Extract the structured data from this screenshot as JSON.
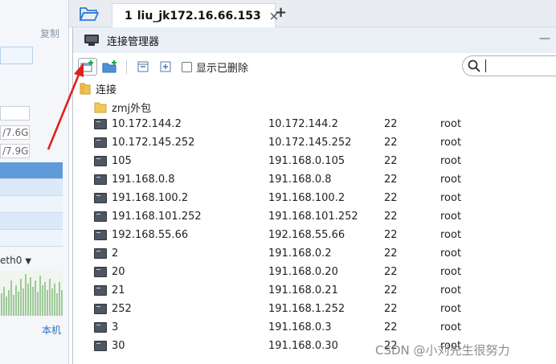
{
  "left_panel": {
    "copy_label": "复制",
    "mem_value_1": "/7.6G",
    "mem_value_2": "/7.9G",
    "interface_select": "eth0",
    "local_label": "本机"
  },
  "tabbar": {
    "folder_icon": "folder-open-icon",
    "session_tab": {
      "number": "1",
      "title": "liu_jk172.16.66.153",
      "close": "×",
      "status_color": "#1bb35b"
    },
    "add_tab": "+"
  },
  "conn_manager": {
    "title": "连接管理器",
    "minimize": "—",
    "toolbar": {
      "new_session_icon": "new-session-icon",
      "new_folder_icon": "new-folder-icon",
      "collapse_icon": "collapse-icon",
      "expand_icon": "expand-icon",
      "show_deleted_label": "显示已删除"
    },
    "search": {
      "placeholder": "",
      "icon": "search-icon"
    },
    "tree": {
      "root_label": "连接",
      "group_label": "zmj外包",
      "sessions": [
        {
          "name": "10.172.144.2",
          "host": "10.172.144.2",
          "port": "22",
          "user": "root"
        },
        {
          "name": "10.172.145.252",
          "host": "10.172.145.252",
          "port": "22",
          "user": "root"
        },
        {
          "name": "105",
          "host": "191.168.0.105",
          "port": "22",
          "user": "root"
        },
        {
          "name": "191.168.0.8",
          "host": "191.168.0.8",
          "port": "22",
          "user": "root"
        },
        {
          "name": "191.168.100.2",
          "host": "191.168.100.2",
          "port": "22",
          "user": "root"
        },
        {
          "name": "191.168.101.252",
          "host": "191.168.101.252",
          "port": "22",
          "user": "root"
        },
        {
          "name": "192.168.55.66",
          "host": "192.168.55.66",
          "port": "22",
          "user": "root"
        },
        {
          "name": "2",
          "host": "191.168.0.2",
          "port": "22",
          "user": "root"
        },
        {
          "name": "20",
          "host": "191.168.0.20",
          "port": "22",
          "user": "root"
        },
        {
          "name": "21",
          "host": "191.168.0.21",
          "port": "22",
          "user": "root"
        },
        {
          "name": "252",
          "host": "191.168.1.252",
          "port": "22",
          "user": "root"
        },
        {
          "name": "3",
          "host": "191.168.0.3",
          "port": "22",
          "user": "root"
        },
        {
          "name": "30",
          "host": "191.168.0.30",
          "port": "22",
          "user": "root"
        }
      ]
    }
  },
  "watermark": "CSDN @小刘先生很努力",
  "colors": {
    "accent_blue": "#2a6fc2",
    "annotation_red": "#e02020",
    "status_green": "#1bb35b"
  }
}
